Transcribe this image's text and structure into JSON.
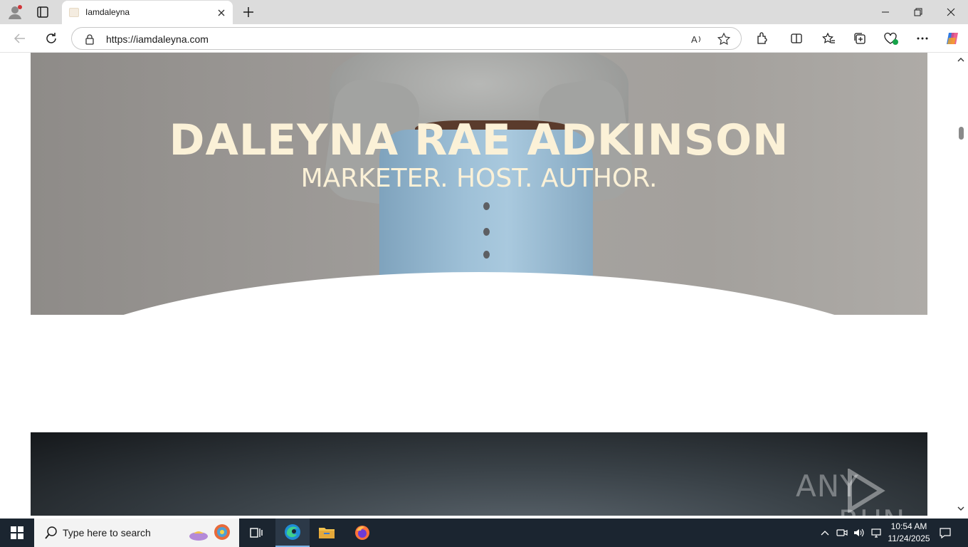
{
  "browser": {
    "tab": {
      "title": "Iamdaleyna"
    },
    "address_bar": {
      "url": "https://iamdaleyna.com"
    }
  },
  "page": {
    "hero": {
      "name": "DALEYNA RAE ADKINSON",
      "tagline": "MARKETER. HOST. AUTHOR."
    },
    "watermark": {
      "left": "ANY",
      "right": "RUN"
    }
  },
  "taskbar": {
    "search_placeholder": "Type here to search",
    "clock": {
      "time": "10:54 AM",
      "date": "11/24/2025"
    }
  },
  "colors": {
    "hero_text": "#fbf1d7",
    "taskbar_bg": "#1b2530",
    "tabstrip_bg": "#dcdcdc"
  }
}
